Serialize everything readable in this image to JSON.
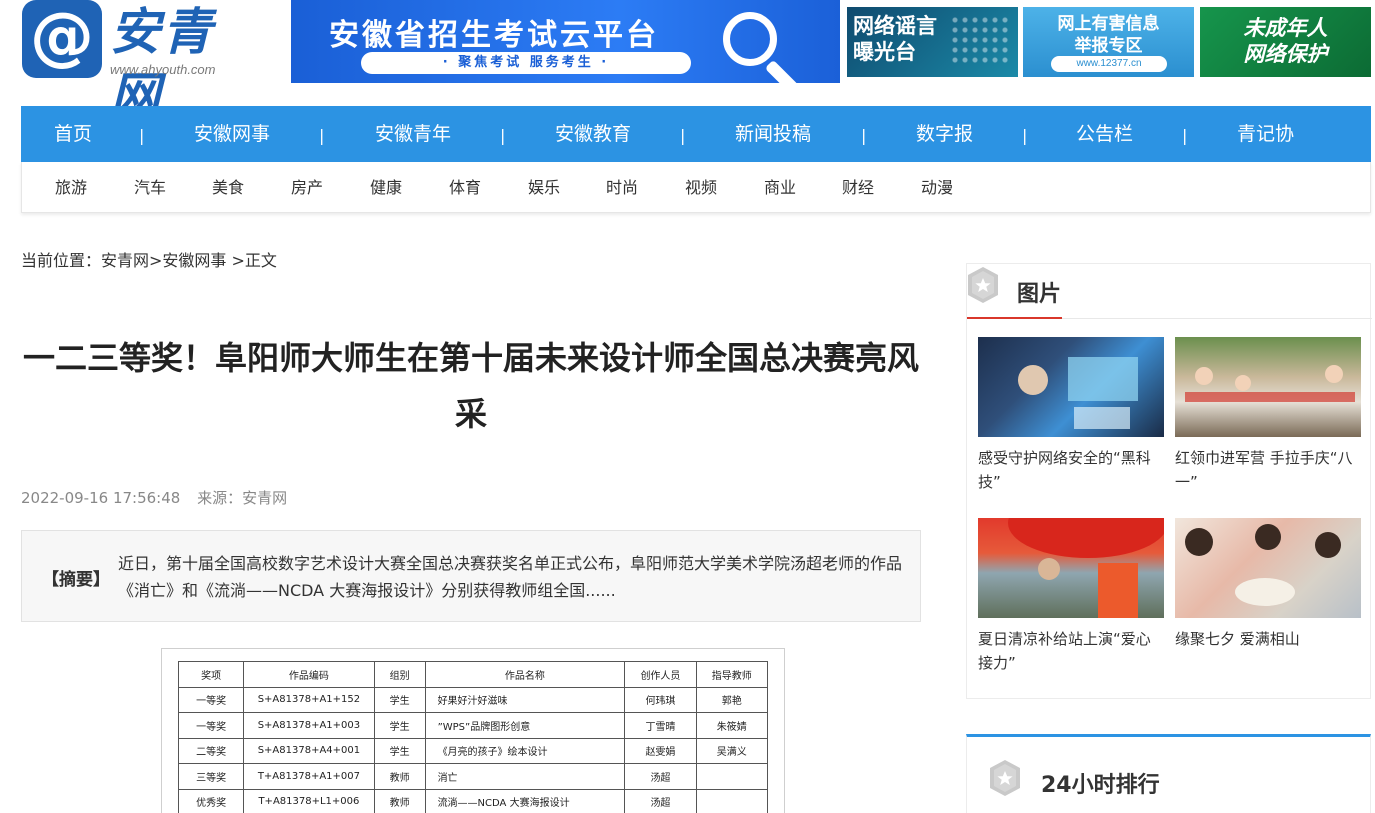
{
  "header": {
    "logo_symbol": "@",
    "logo_name": "安青网",
    "logo_url": "www.ahyouth.com",
    "banner_title": "安徽省招生考试云平台",
    "banner_slogan": "· 聚焦考试  服务考生 ·",
    "ads": [
      {
        "text": "网络谣言\n曝光台"
      },
      {
        "text": "网上有害信息\n举报专区",
        "url": "www.12377.cn"
      },
      {
        "text": "未成年人\n网络保护"
      }
    ],
    "colors": {
      "brand": "#1f63b5",
      "nav": "#2c93e3",
      "accent_red": "#d9372b"
    }
  },
  "nav": {
    "items": [
      "首页",
      "安徽网事",
      "安徽青年",
      "安徽教育",
      "新闻投稿",
      "数字报",
      "公告栏",
      "青记协"
    ],
    "separator": "|",
    "sub_items": [
      "旅游",
      "汽车",
      "美食",
      "房产",
      "健康",
      "体育",
      "娱乐",
      "时尚",
      "视频",
      "商业",
      "财经",
      "动漫"
    ]
  },
  "breadcrumb": {
    "prefix": "当前位置：",
    "path": "安青网>安徽网事 >正文"
  },
  "article": {
    "title": "一二三等奖！阜阳师大师生在第十届未来设计师全国总决赛亮风采",
    "date": "2022-09-16 17:56:48",
    "source": "来源：安青网",
    "summary_label": "【摘要】",
    "summary": "近日，第十届全国高校数字艺术设计大赛全国总决赛获奖名单正式公布，阜阳师范大学美术学院汤超老师的作品《消亡》和《流淌——NCDA 大赛海报设计》分别获得教师组全国......"
  },
  "award_table": {
    "headers": [
      "奖项",
      "作品编码",
      "组别",
      "作品名称",
      "创作人员",
      "指导教师"
    ],
    "rows": [
      [
        "一等奖",
        "S+A81378+A1+152",
        "学生",
        "好果好汁好滋味",
        "何玮琪",
        "郭艳"
      ],
      [
        "一等奖",
        "S+A81378+A1+003",
        "学生",
        "”WPS”品牌图形创意",
        "丁雪晴",
        "朱筱婧"
      ],
      [
        "二等奖",
        "S+A81378+A4+001",
        "学生",
        "《月亮的孩子》绘本设计",
        "赵雯娟",
        "吴满义"
      ],
      [
        "三等奖",
        "T+A81378+A1+007",
        "教师",
        "消亡",
        "汤超",
        ""
      ],
      [
        "优秀奖",
        "T+A81378+L1+006",
        "教师",
        "流淌——NCDA 大赛海报设计",
        "汤超",
        ""
      ]
    ]
  },
  "sidebar": {
    "pictures_title": "图片",
    "pictures": [
      {
        "caption": "感受守护网络安全的“黑科技”"
      },
      {
        "caption": "红领巾进军营 手拉手庆“八一”"
      },
      {
        "caption": "夏日清凉补给站上演“爱心接力”"
      },
      {
        "caption": "缘聚七夕 爱满相山"
      }
    ],
    "ranking_title": "24小时排行"
  }
}
